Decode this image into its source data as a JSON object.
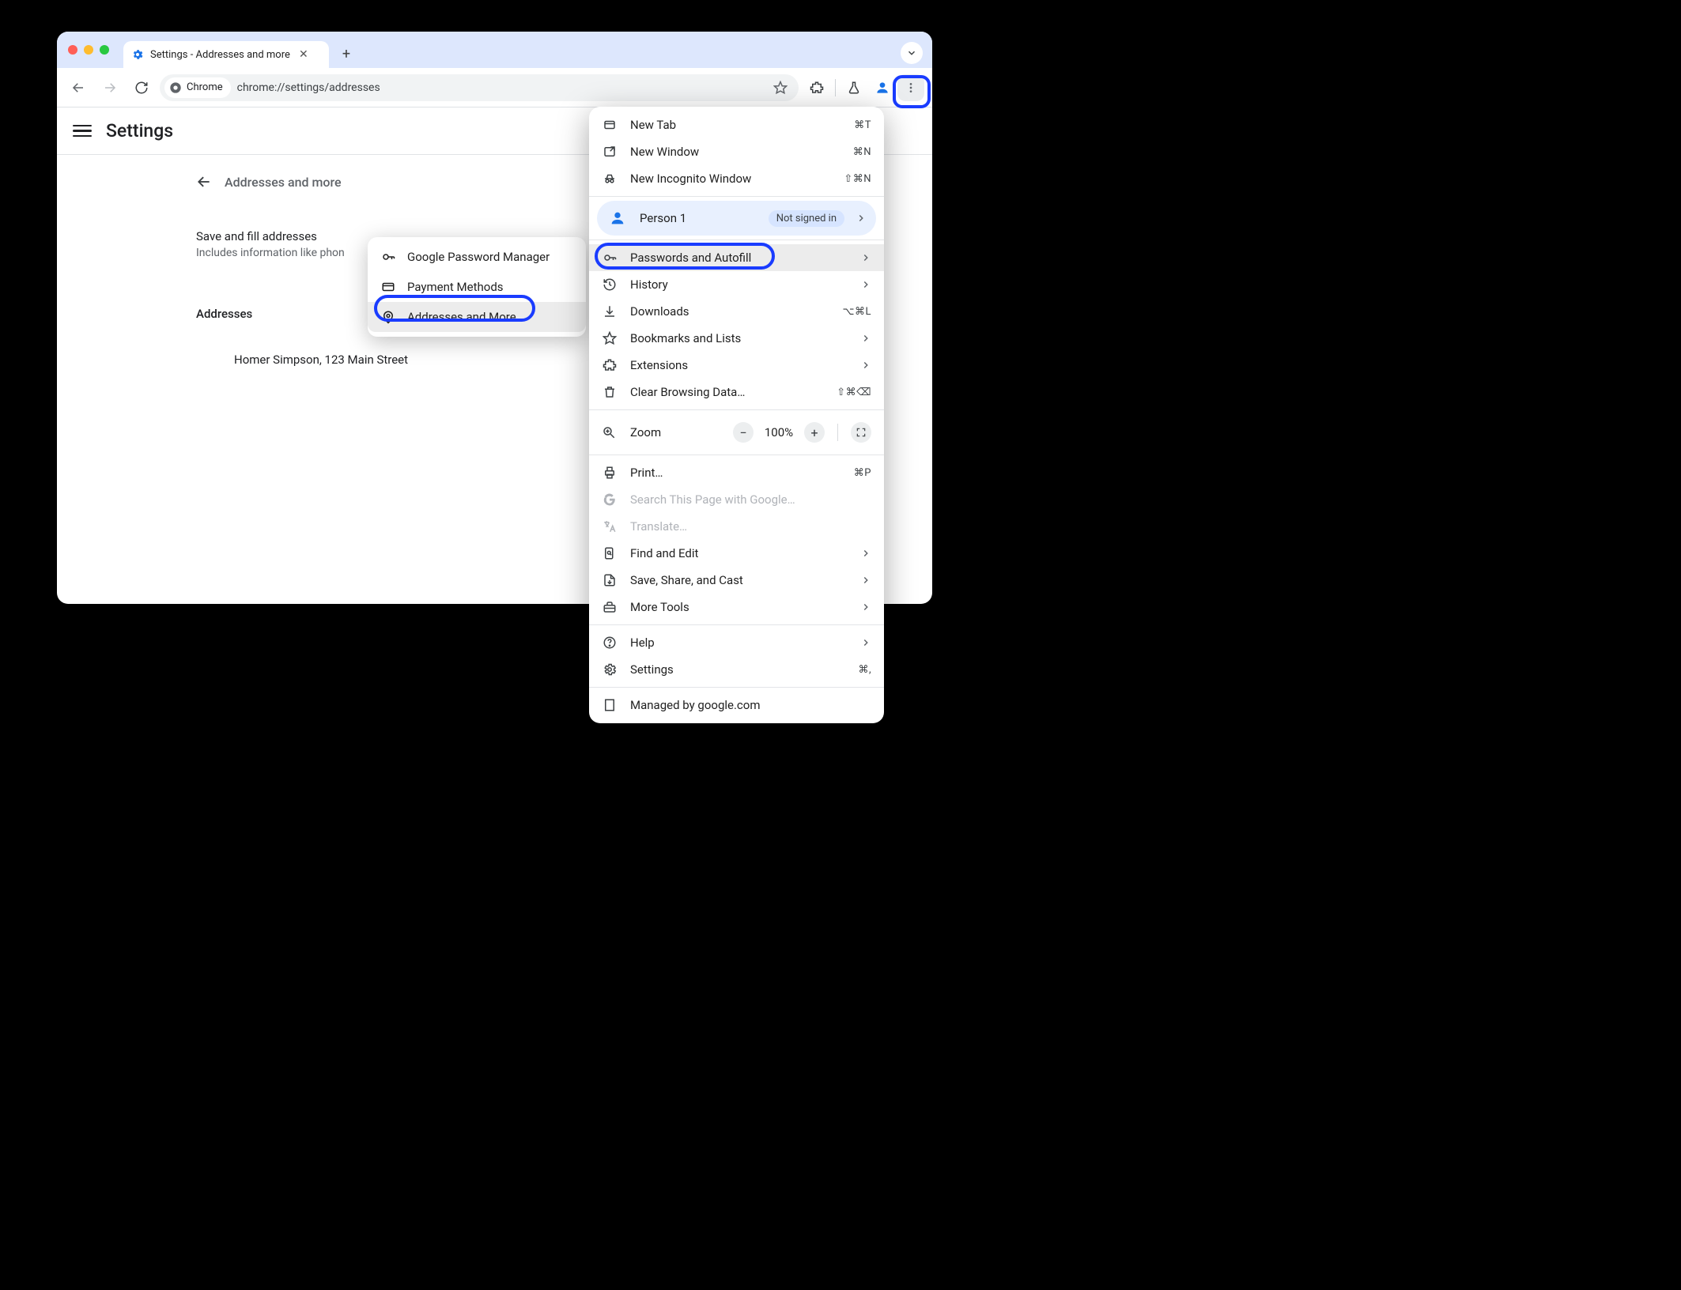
{
  "tab": {
    "title": "Settings - Addresses and more"
  },
  "omnibox": {
    "chip": "Chrome",
    "url": "chrome://settings/addresses"
  },
  "settings": {
    "title": "Settings",
    "breadcrumb": "Addresses and more",
    "save_row": "Save and fill addresses",
    "save_sub": "Includes information like phon",
    "addresses_heading": "Addresses",
    "address_entry": "Homer Simpson, 123 Main Street"
  },
  "submenu": {
    "items": [
      {
        "label": "Google Password Manager"
      },
      {
        "label": "Payment Methods"
      },
      {
        "label": "Addresses and More"
      }
    ]
  },
  "menu": {
    "new_tab": {
      "label": "New Tab",
      "shortcut": "⌘T"
    },
    "new_window": {
      "label": "New Window",
      "shortcut": "⌘N"
    },
    "new_incognito": {
      "label": "New Incognito Window",
      "shortcut": "⇧⌘N"
    },
    "profile": {
      "name": "Person 1",
      "badge": "Not signed in"
    },
    "passwords": {
      "label": "Passwords and Autofill"
    },
    "history": {
      "label": "History"
    },
    "downloads": {
      "label": "Downloads",
      "shortcut": "⌥⌘L"
    },
    "bookmarks": {
      "label": "Bookmarks and Lists"
    },
    "extensions": {
      "label": "Extensions"
    },
    "clear": {
      "label": "Clear Browsing Data…",
      "shortcut": "⇧⌘⌫"
    },
    "zoom": {
      "label": "Zoom",
      "value": "100%"
    },
    "print": {
      "label": "Print…",
      "shortcut": "⌘P"
    },
    "search": {
      "label": "Search This Page with Google…"
    },
    "translate": {
      "label": "Translate…"
    },
    "find": {
      "label": "Find and Edit"
    },
    "save_share": {
      "label": "Save, Share, and Cast"
    },
    "more_tools": {
      "label": "More Tools"
    },
    "help": {
      "label": "Help"
    },
    "settings_item": {
      "label": "Settings",
      "shortcut": "⌘,"
    },
    "managed": {
      "label": "Managed by google.com"
    }
  }
}
